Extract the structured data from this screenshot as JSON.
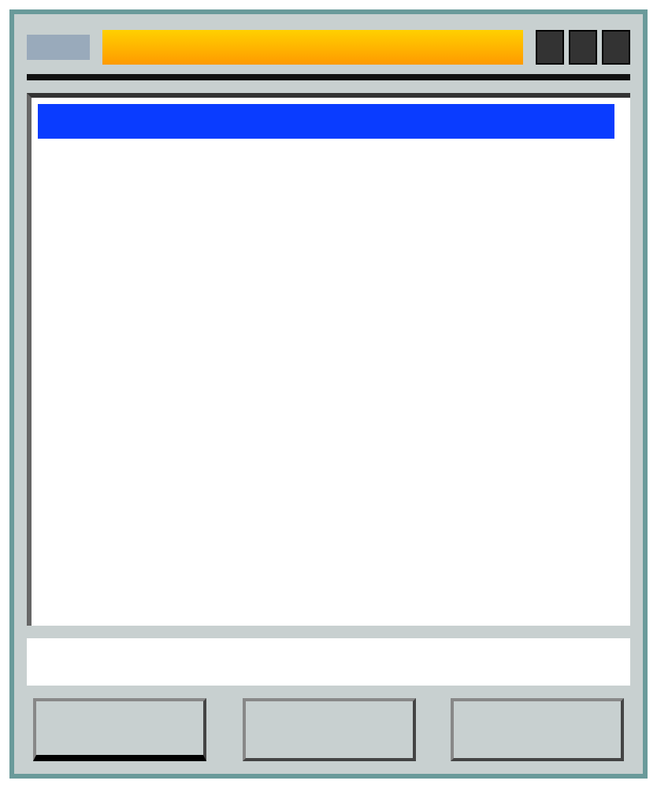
{
  "window": {
    "active": true
  },
  "list": {
    "rows": [
      {
        "selected": true
      }
    ]
  },
  "buttons": [
    {
      "default": true
    },
    {
      "default": false
    },
    {
      "default": false
    }
  ]
}
